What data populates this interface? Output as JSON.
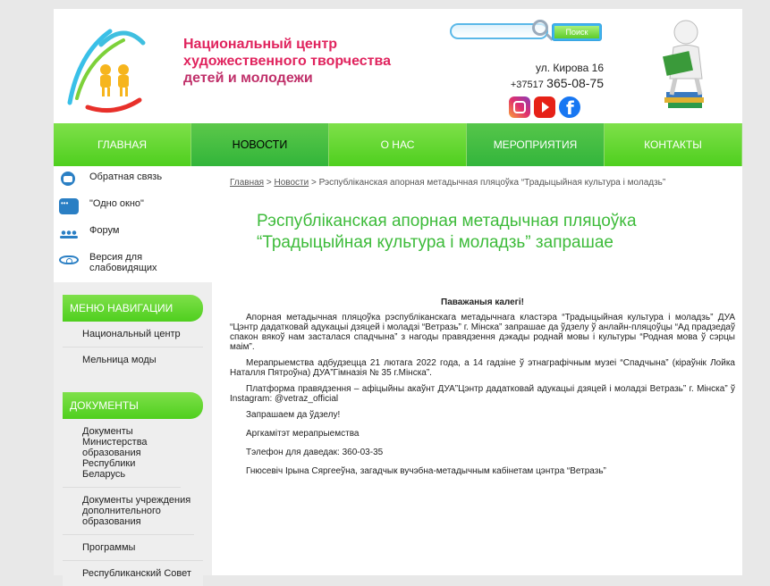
{
  "header": {
    "title_line1": "Национальный центр",
    "title_line2": "художественного творчества",
    "title_line3": "детей и молодежи",
    "search_placeholder": "",
    "search_button": "Поиск",
    "address": "ул. Кирова 16",
    "phone_prefix": "+37517",
    "phone_number": "365-08-75",
    "social": [
      "instagram-icon",
      "youtube-icon",
      "facebook-icon"
    ]
  },
  "nav": [
    {
      "label": "ГЛАВНАЯ"
    },
    {
      "label": "НОВОСТИ"
    },
    {
      "label": "О НАС"
    },
    {
      "label": "МЕРОПРИЯТИЯ"
    },
    {
      "label": "КОНТАКТЫ"
    }
  ],
  "sidebar": {
    "quick": [
      {
        "label": "Обратная связь",
        "icon": "chat-icon"
      },
      {
        "label": "\"Одно окно\"",
        "icon": "window-icon"
      },
      {
        "label": "Форум",
        "icon": "forum-icon"
      },
      {
        "label": "Версия для слабовидящих",
        "icon": "eye-icon"
      }
    ],
    "nav_menu": {
      "title": "МЕНЮ НАВИГАЦИИ",
      "items": [
        "Национальный центр",
        "Мельница моды"
      ]
    },
    "documents": {
      "title": "ДОКУМЕНТЫ",
      "items": [
        "Документы Министерства образования Республики Беларусь",
        "Документы учреждения дополнительного образования",
        "Программы",
        "Республиканский Совет"
      ]
    }
  },
  "breadcrumb": {
    "home": "Главная",
    "sep": ">",
    "news": "Новости",
    "current": "Рэспубліканская апорная метадычная пляцоўка “Традыцыйная культура і моладзь”"
  },
  "article": {
    "title": "Рэспубліканская апорная метадычная пляцоўка “Традыцыйная культура і моладзь” запрашае",
    "greeting": "Паважаныя калегі!",
    "p1": "Апорная метадычная пляцоўка рэспубліканскага метадычнага кластэра “Традыцыйная культура і моладзь” ДУА “Цэнтр дадатковай адукацыі дзяцей і моладзі “Ветразь” г. Мінска” запрашае да ўдзелу ў анлайн-пляцоўцы “Ад прадзедаў спакон вякоў нам засталася спадчына” з нагоды правядзення дэкады роднай мовы і культуры “Родная мова ў сэрцы маім”.",
    "p2": "Мерапрыемства адбудзецца 21 лютага 2022 года, а 14 гадзіне ў этнаграфічным музеі “Спадчына” (кіраўнік Лойка Наталля Пятроўна) ДУА”Гімназія № 35 г.Мінска”.",
    "p3": "Платформа правядзення – афіцыйны акаўнт ДУА”Цэнтр дадатковай адукацыі дзяцей і моладзі Ветразь” г. Мінска” ў Instagram: @vetraz_official",
    "p4": "Запрашаем да ўдзелу!",
    "p5": "Аргкамітэт мерапрыемства",
    "p6": "Тэлефон для даведак: 360-03-35",
    "p7": "Гнюсевіч Ірына Сяргееўна, загадчык вучэбна-метадычным кабінетам цэнтра “Ветразь”"
  },
  "colors": {
    "accent_green": "#4fcf1e",
    "title_pink": "#e0245e",
    "article_title_green": "#3dbb3a"
  }
}
